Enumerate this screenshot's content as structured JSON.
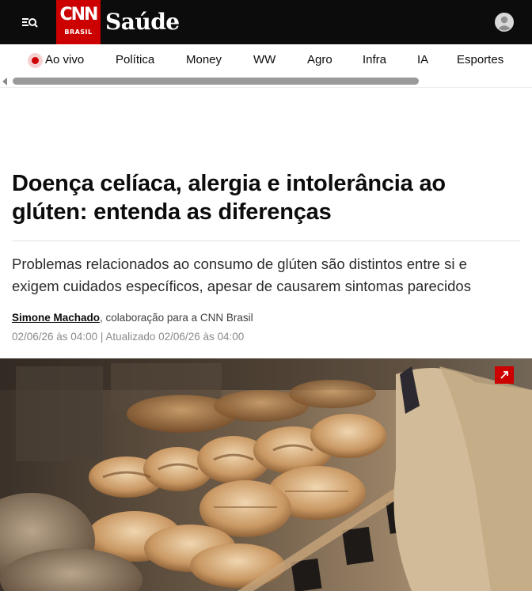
{
  "header": {
    "logo_text": "CNN",
    "logo_sub": "BRASIL",
    "section": "Saúde"
  },
  "nav": {
    "items": [
      {
        "label": "Ao vivo"
      },
      {
        "label": "Política"
      },
      {
        "label": "Money"
      },
      {
        "label": "WW"
      },
      {
        "label": "Agro"
      },
      {
        "label": "Infra"
      },
      {
        "label": "IA"
      },
      {
        "label": "Esportes"
      }
    ]
  },
  "article": {
    "headline": "Doença celíaca, alergia e intolerância ao glúten: entenda as diferenças",
    "subheadline": "Problemas relacionados ao consumo de glúten são distintos entre si e exigem cuidados específicos, apesar de causarem sintomas parecidos",
    "author": "Simone Machado",
    "byline_rest": ", colaboração para a CNN Brasil",
    "published": "02/06/26 às 04:00",
    "separator": " | ",
    "updated": "Atualizado 02/06/26 às 04:00"
  },
  "colors": {
    "brand_red": "#cc0000",
    "header_bg": "#0c0c0c"
  },
  "icons": {
    "menu": "menu-search-icon",
    "account": "user-avatar-icon",
    "expand": "expand-arrow-icon"
  }
}
